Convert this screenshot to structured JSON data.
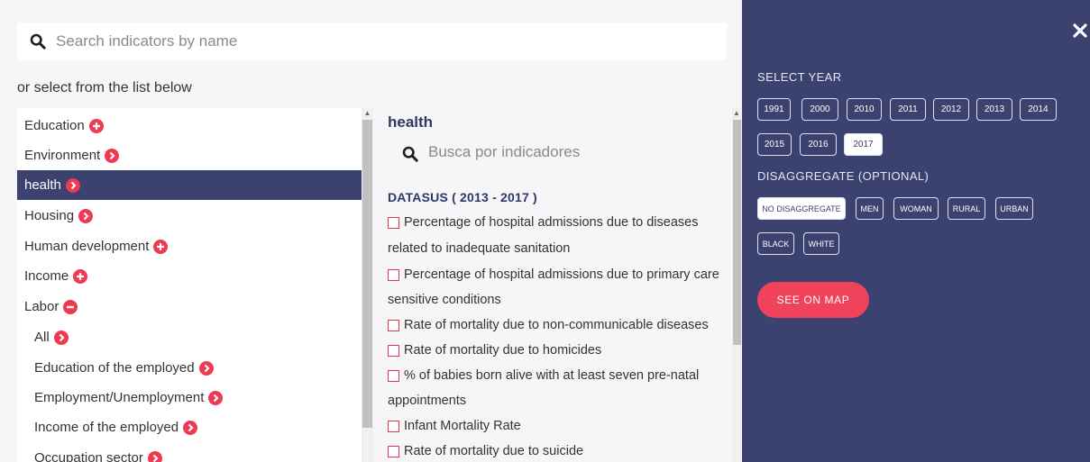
{
  "search": {
    "placeholder": "Search indicators by name"
  },
  "or_select": "or select from the list below",
  "categories": [
    {
      "label": "Education",
      "icon": "plus-circle-icon"
    },
    {
      "label": "Environment",
      "icon": "chevron-right-circle-icon"
    },
    {
      "label": "health",
      "icon": "chevron-right-circle-icon",
      "active": true
    },
    {
      "label": "Housing",
      "icon": "chevron-right-circle-icon"
    },
    {
      "label": "Human development",
      "icon": "plus-circle-icon"
    },
    {
      "label": "Income",
      "icon": "plus-circle-icon"
    },
    {
      "label": "Labor",
      "icon": "minus-circle-icon"
    },
    {
      "label": "All",
      "icon": "chevron-right-circle-icon",
      "sub": true
    },
    {
      "label": "Education of the employed",
      "icon": "chevron-right-circle-icon",
      "sub": true
    },
    {
      "label": "Employment/Unemployment",
      "icon": "chevron-right-circle-icon",
      "sub": true
    },
    {
      "label": "Income of the employed",
      "icon": "chevron-right-circle-icon",
      "sub": true
    },
    {
      "label": "Occupation sector",
      "icon": "chevron-right-circle-icon",
      "sub": true
    }
  ],
  "indicators": {
    "title": "health",
    "search_placeholder": "Busca por indicadores",
    "dataset_heading": "DATASUS ( 2013 - 2017 )",
    "items": [
      {
        "line1": "Percentage of hospital admissions due to diseases",
        "line2": "related to inadequate sanitation"
      },
      {
        "line1": "Percentage of hospital admissions due to primary care",
        "line2": "sensitive conditions"
      },
      {
        "line1": "Rate of mortality due to non-communicable diseases"
      },
      {
        "line1": "Rate of mortality due to homicides"
      },
      {
        "line1": "% of babies born alive with at least seven pre-natal",
        "line2": "appointments"
      },
      {
        "line1": "Infant Mortality Rate"
      },
      {
        "line1": "Rate of mortality due to suicide"
      }
    ]
  },
  "filters": {
    "year_label": "SELECT YEAR",
    "years": [
      "1991",
      "2000",
      "2010",
      "2011",
      "2012",
      "2013",
      "2014",
      "2015",
      "2016",
      "2017"
    ],
    "selected_year": "2017",
    "disaggregate_label": "DISAGGREGATE (OPTIONAL)",
    "disaggregates": [
      "NO DISAGGREGATE",
      "MEN",
      "WOMAN",
      "RURAL",
      "URBAN",
      "BLACK",
      "WHITE"
    ],
    "selected_disaggregate": "NO DISAGGREGATE",
    "see_on_map": "SEE ON MAP"
  },
  "colors": {
    "navy": "#3b4270",
    "accent_red": "#ee3a52",
    "button_red": "#f0425a"
  }
}
